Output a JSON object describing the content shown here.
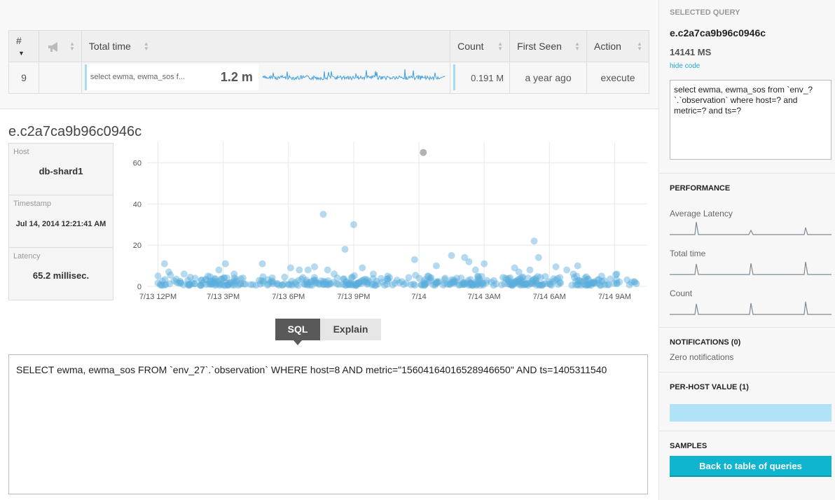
{
  "table": {
    "headers": {
      "num": "#",
      "total": "Total time",
      "count": "Count",
      "first_seen": "First Seen",
      "action": "Action"
    },
    "row": {
      "num": "9",
      "query_short": "select ewma, ewma_sos f...",
      "total_time": "1.2 m",
      "count": "0.191 M",
      "first_seen": "a year ago",
      "action": "execute"
    }
  },
  "detail": {
    "title": "e.c2a7ca9b96c0946c",
    "host_label": "Host",
    "host": "db-shard1",
    "timestamp_label": "Timestamp",
    "timestamp": "Jul 14, 2014 12:21:41 AM",
    "latency_label": "Latency",
    "latency": "65.2 millisec."
  },
  "chart_data": {
    "type": "scatter",
    "y_ticks": [
      "0",
      "20",
      "40",
      "60"
    ],
    "ylim": [
      0,
      70
    ],
    "x_ticks": [
      "7/13 12PM",
      "7/13 3PM",
      "7/13 6PM",
      "7/13 9PM",
      "7/14",
      "7/14 3AM",
      "7/14 6AM",
      "7/14 9AM"
    ],
    "x_range_hours": [
      -0.5,
      22.5
    ],
    "grid": true,
    "series": [
      {
        "color": "#5aaedb",
        "points": [
          [
            0.3,
            11
          ],
          [
            0.5,
            7
          ],
          [
            1.2,
            6
          ],
          [
            1.7,
            4
          ],
          [
            2.3,
            5
          ],
          [
            2.8,
            8
          ],
          [
            3.1,
            11
          ],
          [
            3.5,
            6
          ],
          [
            4.8,
            11
          ],
          [
            6.1,
            9
          ],
          [
            6.5,
            8
          ],
          [
            6.9,
            8
          ],
          [
            7.2,
            9.5
          ],
          [
            7.6,
            35
          ],
          [
            7.8,
            8
          ],
          [
            8.1,
            6
          ],
          [
            8.6,
            18
          ],
          [
            9.0,
            30
          ],
          [
            9.4,
            9
          ],
          [
            9.9,
            6
          ],
          [
            11.8,
            13
          ],
          [
            12.4,
            5
          ],
          [
            12.8,
            10
          ],
          [
            13.5,
            15
          ],
          [
            14.1,
            14
          ],
          [
            14.3,
            12
          ],
          [
            14.6,
            8
          ],
          [
            15.0,
            11
          ],
          [
            16.4,
            9
          ],
          [
            16.6,
            7
          ],
          [
            17.1,
            8
          ],
          [
            17.3,
            22
          ],
          [
            17.5,
            14
          ],
          [
            18.3,
            9.5
          ],
          [
            18.8,
            8
          ],
          [
            19.1,
            6
          ],
          [
            19.3,
            10
          ],
          [
            20.4,
            5
          ],
          [
            21.1,
            6
          ]
        ]
      },
      {
        "color": "#aaaaaa",
        "points": [
          [
            12.2,
            65
          ]
        ]
      }
    ]
  },
  "tabs": {
    "sql": "SQL",
    "explain": "Explain"
  },
  "sql_text": "SELECT ewma, ewma_sos FROM `env_27`.`observation` WHERE host=8 AND metric=\"15604164016528946650\" AND ts=1405311540",
  "sidebar": {
    "selected_head": "SELECTED QUERY",
    "selected_id": "e.c2a7ca9b96c0946c",
    "selected_ms": "14141 MS",
    "hide_code": "hide code",
    "code": "select ewma, ewma_sos from `env_?`.`observation` where host=? and metric=? and ts=?",
    "performance_head": "PERFORMANCE",
    "avg_latency": "Average Latency",
    "total_time": "Total time",
    "count": "Count",
    "notifications_head": "NOTIFICATIONS (0)",
    "notifications_text": "Zero notifications",
    "perhost_head": "PER-HOST VALUE (1)",
    "samples_head": "SAMPLES",
    "back_button": "Back to table of queries"
  }
}
